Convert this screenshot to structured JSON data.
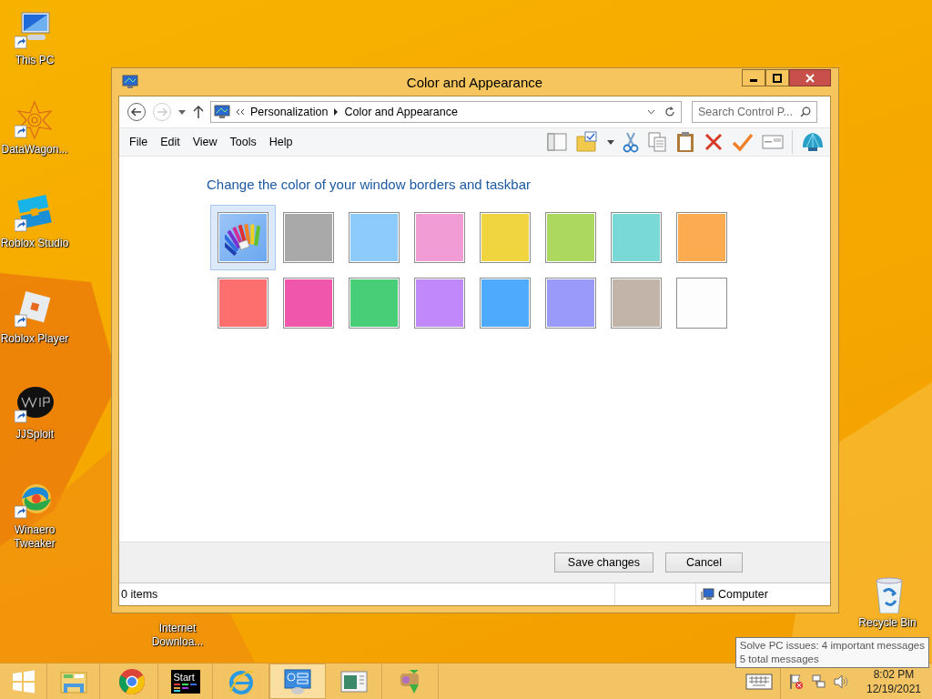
{
  "desktop_icons": [
    {
      "label": "This PC"
    },
    {
      "label": "DataWagon..."
    },
    {
      "label": "Roblox Studio"
    },
    {
      "label": "Roblox Player"
    },
    {
      "label": "JJSploit"
    },
    {
      "label": "Winaero Tweaker"
    },
    {
      "label": "Internet Downloa..."
    },
    {
      "label": "Recycle Bin"
    }
  ],
  "window": {
    "title": "Color and Appearance",
    "breadcrumbs": [
      "Personalization",
      "Color and Appearance"
    ],
    "search": {
      "placeholder": "Search Control P..."
    },
    "menu": [
      "File",
      "Edit",
      "View",
      "Tools",
      "Help"
    ],
    "heading": "Change the color of your window borders and taskbar",
    "swatches": [
      {
        "kind": "custom",
        "selected": true
      },
      {
        "kind": "color",
        "color": "#a9a9a9",
        "selected": false
      },
      {
        "kind": "color",
        "color": "#8ccbfb",
        "selected": false
      },
      {
        "kind": "color",
        "color": "#f19cd4",
        "selected": false
      },
      {
        "kind": "color",
        "color": "#f0d541",
        "selected": false
      },
      {
        "kind": "color",
        "color": "#acd85f",
        "selected": false
      },
      {
        "kind": "color",
        "color": "#79d9d6",
        "selected": false
      },
      {
        "kind": "color",
        "color": "#fdab50",
        "selected": false
      },
      {
        "kind": "color",
        "color": "#fd6e6e",
        "selected": false
      },
      {
        "kind": "color",
        "color": "#f056ab",
        "selected": false
      },
      {
        "kind": "color",
        "color": "#48ce76",
        "selected": false
      },
      {
        "kind": "color",
        "color": "#c088fb",
        "selected": false
      },
      {
        "kind": "color",
        "color": "#4eaafd",
        "selected": false
      },
      {
        "kind": "color",
        "color": "#9a9afb",
        "selected": false
      },
      {
        "kind": "color",
        "color": "#c2b4a8",
        "selected": false
      },
      {
        "kind": "color",
        "color": "#fdfdfd",
        "selected": false
      }
    ],
    "buttons": [
      "Save changes",
      "Cancel"
    ],
    "status_bar": {
      "items": "0 items",
      "zone": "Computer"
    }
  },
  "tooltip": {
    "lines": [
      "Solve PC issues: 4 important messages",
      "5 total messages"
    ]
  },
  "taskbar": {
    "buttons": [
      {
        "active": false
      },
      {
        "active": false
      },
      {
        "active": false
      },
      {
        "active": false,
        "label": "Start"
      },
      {
        "active": false
      },
      {
        "active": true
      },
      {
        "active": false
      },
      {
        "active": false
      }
    ],
    "tray": {
      "time": "8:02 PM",
      "date": "12/19/2021"
    }
  }
}
